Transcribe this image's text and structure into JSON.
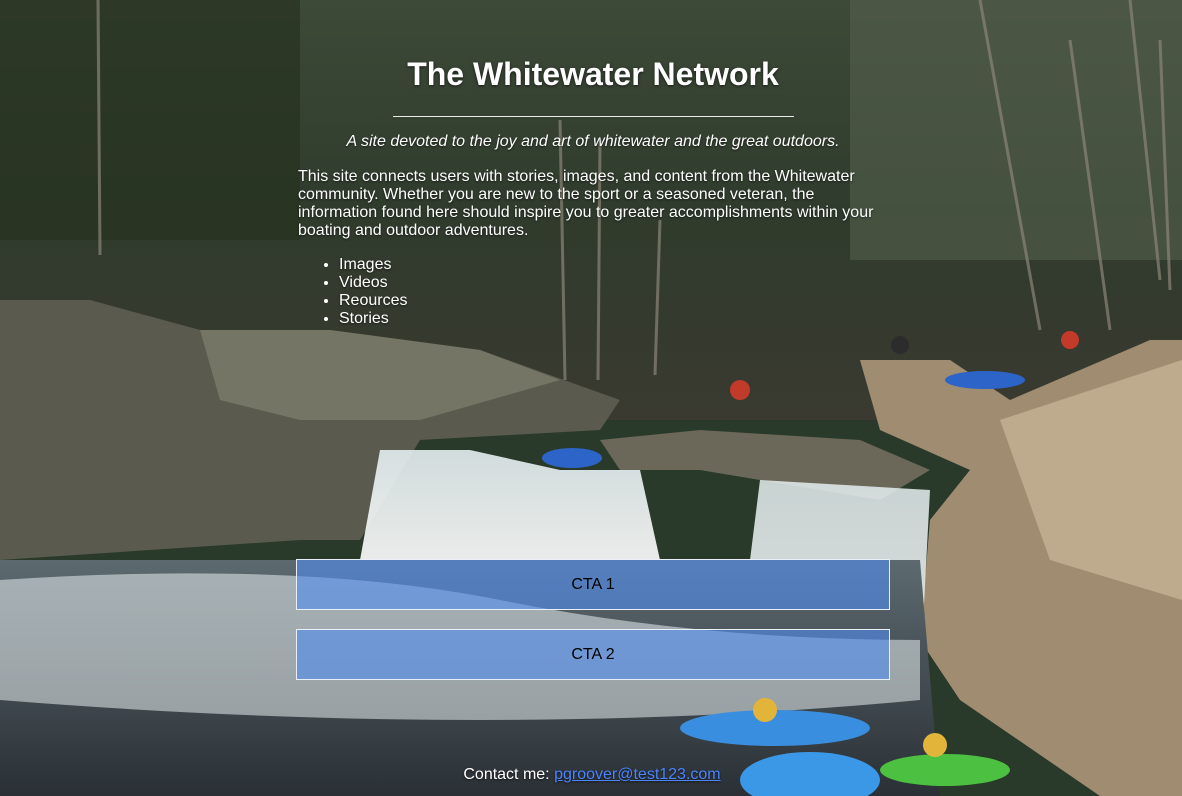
{
  "header": {
    "title": "The Whitewater Network",
    "tagline": "A site devoted to the joy and art of whitewater and the great outdoors."
  },
  "intro": {
    "text": "This site connects users with stories, images, and content from the Whitewater community. Whether you are new to the sport or a seasoned veteran, the information found here should inspire you to greater accomplishments within your boating and outdoor adventures."
  },
  "links": [
    {
      "label": "Images"
    },
    {
      "label": "Videos"
    },
    {
      "label": "Reources"
    },
    {
      "label": "Stories"
    }
  ],
  "cta": {
    "primary_label": "CTA 1",
    "secondary_label": "CTA 2"
  },
  "footer": {
    "contact_label": "Contact me:",
    "contact_email": "pgroover@test123.com"
  },
  "colors": {
    "title_text": "#ffffff",
    "cta_background": "#508ceb",
    "link": "#4a84ff"
  }
}
